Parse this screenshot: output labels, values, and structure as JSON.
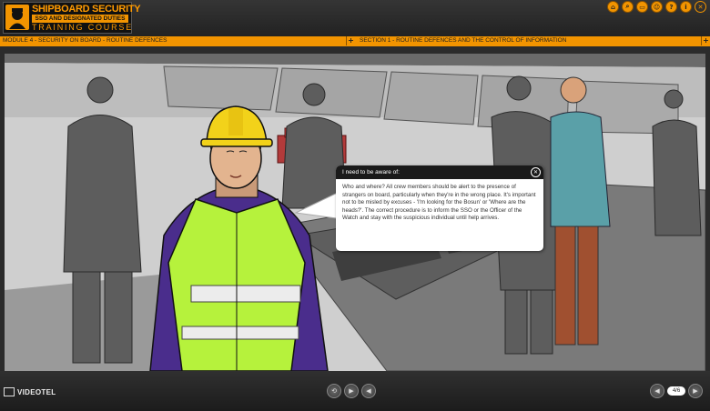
{
  "header": {
    "logo_line1": "SHIPBOARD SECURITY",
    "logo_line2": "SSO AND DESIGNATED DUTIES",
    "logo_line3": "TRAINING COURSE",
    "icons": [
      "home-icon",
      "search-icon",
      "info-icon",
      "glossary-icon",
      "help-icon",
      "print-icon",
      "close-icon"
    ]
  },
  "modbar": {
    "module": "MODULE 4 - SECURITY ON BOARD - ROUTINE DEFENCES",
    "section": "SECTION 1 - ROUTINE DEFENCES AND THE CONTROL OF INFORMATION",
    "expand": "+"
  },
  "bubble": {
    "title": "I need to be aware of:",
    "text": "Who and where? All crew members should be alert to the presence of strangers on board, particularly when they're in the wrong place. It's important not to be misled by excuses - 'I'm looking for the Bosun' or 'Where are the heads?'. The correct procedure is to inform the SSO or the Officer of the Watch and stay with the suspicious individual until help arrives."
  },
  "footer": {
    "brand": "VIDEOTEL",
    "page": "4/6"
  },
  "colors": {
    "accent": "#f29400",
    "vest": "#b6f23c",
    "overalls": "#4a2d8c"
  }
}
